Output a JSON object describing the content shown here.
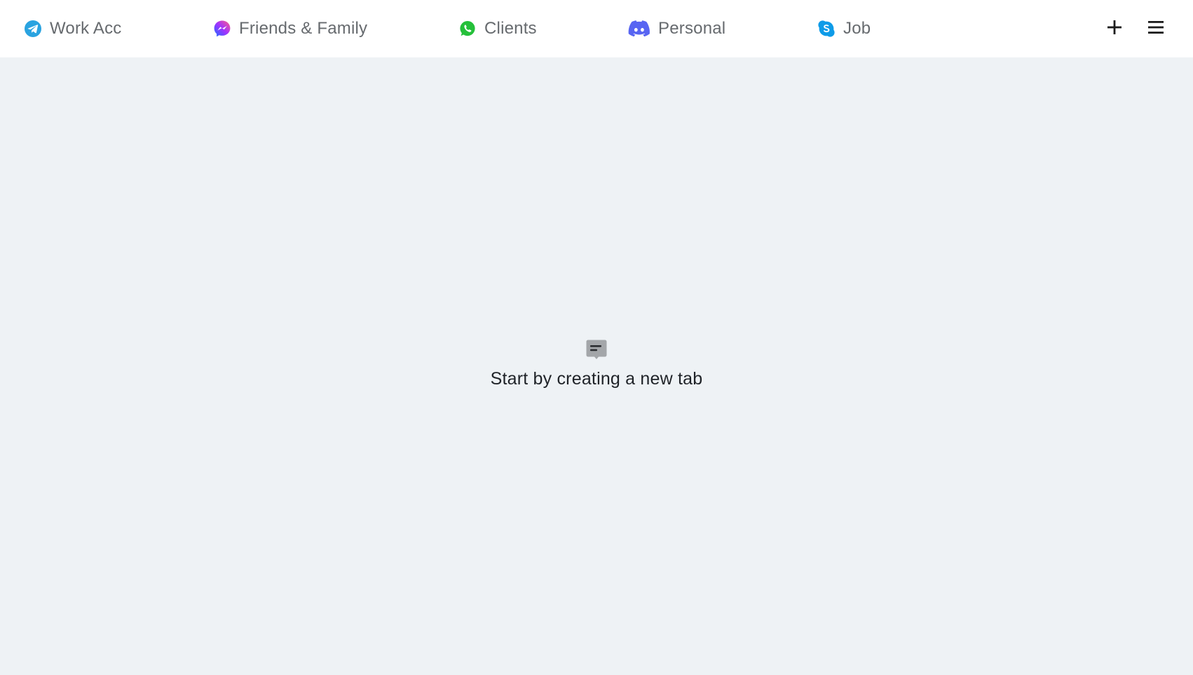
{
  "tabs": [
    {
      "label": "Work Acc",
      "icon": "telegram-icon",
      "color": "#2aa3e0"
    },
    {
      "label": "Friends & Family",
      "icon": "messenger-icon",
      "color": "#a033ff"
    },
    {
      "label": "Clients",
      "icon": "whatsapp-icon",
      "color": "#25c03a"
    },
    {
      "label": "Personal",
      "icon": "discord-icon",
      "color": "#5865f2"
    },
    {
      "label": "Job",
      "icon": "skype-icon",
      "color": "#0e9be8"
    }
  ],
  "actions": {
    "add_icon": "plus-icon",
    "menu_icon": "hamburger-menu-icon"
  },
  "empty_state": {
    "icon": "message-bubble-icon",
    "text": "Start by creating a new tab"
  },
  "colors": {
    "topbar_bg": "#ffffff",
    "main_bg": "#eef2f5",
    "tab_text": "#666a6e",
    "empty_text": "#1f2328"
  }
}
